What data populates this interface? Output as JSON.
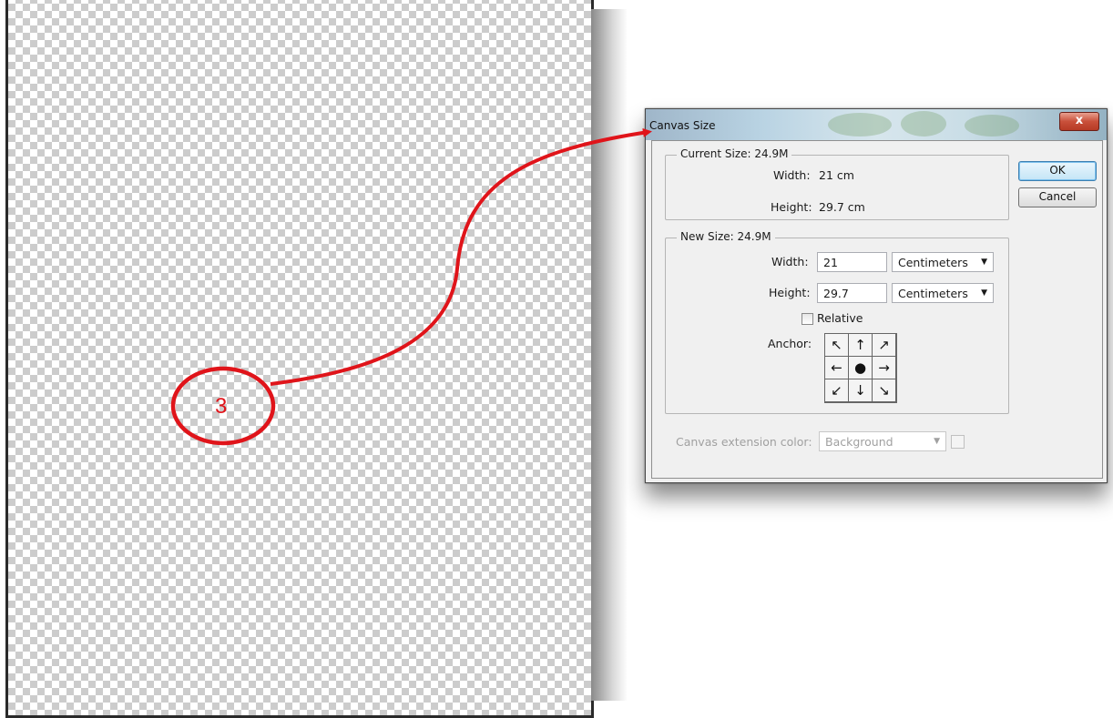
{
  "dialog": {
    "title": "Canvas Size",
    "close_label": "x",
    "ok_label": "OK",
    "cancel_label": "Cancel",
    "current_size": {
      "title": "Current Size: 24.9M",
      "width_label": "Width:",
      "width_value": "21 cm",
      "height_label": "Height:",
      "height_value": "29.7 cm"
    },
    "new_size": {
      "title": "New Size: 24.9M",
      "width_label": "Width:",
      "width_value": "21",
      "width_unit": "Centimeters",
      "height_label": "Height:",
      "height_value": "29.7",
      "height_unit": "Centimeters",
      "relative_label": "Relative",
      "anchor_label": "Anchor:"
    },
    "extension": {
      "label": "Canvas extension color:",
      "value": "Background"
    }
  },
  "annotation": {
    "step_number": "3",
    "color": "#e0141a"
  },
  "icons": {
    "anchor": [
      "arrow-nw-icon",
      "arrow-n-icon",
      "arrow-ne-icon",
      "arrow-w-icon",
      "anchor-dot-icon",
      "arrow-e-icon",
      "arrow-sw-icon",
      "arrow-s-icon",
      "arrow-se-icon"
    ]
  }
}
